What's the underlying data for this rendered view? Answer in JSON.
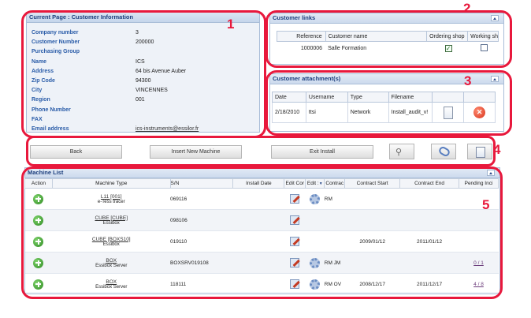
{
  "customer_info": {
    "title": "Current Page : Customer Information",
    "rows": [
      {
        "label": "Company number",
        "value": "3"
      },
      {
        "label": "Customer Number",
        "value": "200000"
      },
      {
        "label": "Purchasing Group",
        "value": ""
      },
      {
        "label": "Name",
        "value": "ICS"
      },
      {
        "label": "Address",
        "value": "64 bis Avenue Auber"
      },
      {
        "label": "Zip Code",
        "value": "94300"
      },
      {
        "label": "City",
        "value": "VINCENNES"
      },
      {
        "label": "Region",
        "value": "001"
      },
      {
        "label": "Phone Number",
        "value": ""
      },
      {
        "label": "FAX",
        "value": ""
      },
      {
        "label": "Email address",
        "value": "ics-instruments@essilor.fr"
      }
    ]
  },
  "customer_links": {
    "title": "Customer links",
    "headers": [
      "Reference",
      "Customer name",
      "Ordering shop",
      "Working sh"
    ],
    "rows": [
      {
        "reference": "1000006",
        "name": "Salle Formation",
        "ordering_shop": true,
        "working_shop": false
      }
    ]
  },
  "attachments": {
    "title": "Customer attachment(s)",
    "headers": [
      "Date",
      "Username",
      "Type",
      "Filename"
    ],
    "rows": [
      {
        "date": "2/18/2010",
        "username": "ttsi",
        "type": "Network",
        "filename": "Install_audit_v!"
      }
    ]
  },
  "toolbar": {
    "back": "Back",
    "insert": "Insert New Machine",
    "exit": "Exit Install"
  },
  "machine_list": {
    "title": "Machine List",
    "headers": [
      "Action",
      "Machine Type",
      "S/N",
      "Install Date",
      "Edit Cor",
      "Edit :",
      "Contrac",
      "Contract Start",
      "Contract End",
      "Pending Inci"
    ],
    "rows": [
      {
        "type_link": "L11 [001]",
        "type_sub": "e-Tess tracer",
        "sn": "069116",
        "install_date": "",
        "gear": true,
        "contract": "RM",
        "start": "",
        "end": "",
        "pending": ""
      },
      {
        "type_link": "CUBE [CUBE]",
        "type_sub": "Essibox",
        "sn": "098106",
        "install_date": "",
        "gear": false,
        "contract": "",
        "start": "",
        "end": "",
        "pending": ""
      },
      {
        "type_link": "CUBE [BOXS10]",
        "type_sub": "Essibox",
        "sn": "019110",
        "install_date": "",
        "gear": false,
        "contract": "",
        "start": "2009/01/12",
        "end": "2011/01/12",
        "pending": ""
      },
      {
        "type_link": "BOX",
        "type_sub": "Essibox Server",
        "sn": "BOXSRV019108",
        "install_date": "",
        "gear": true,
        "contract": "RM JM",
        "start": "",
        "end": "",
        "pending": "0 / 1"
      },
      {
        "type_link": "BOX",
        "type_sub": "Essibox Server",
        "sn": "118111",
        "install_date": "",
        "gear": true,
        "contract": "RM OV",
        "start": "2008/12/17",
        "end": "2011/12/17",
        "pending": "4 / 8"
      }
    ]
  },
  "callouts": [
    "1",
    "2",
    "3",
    "4",
    "5"
  ],
  "colors": {
    "callout_red": "#e8183c",
    "label_blue": "#2a5ca8",
    "header_blue": "#1b3e7d"
  }
}
